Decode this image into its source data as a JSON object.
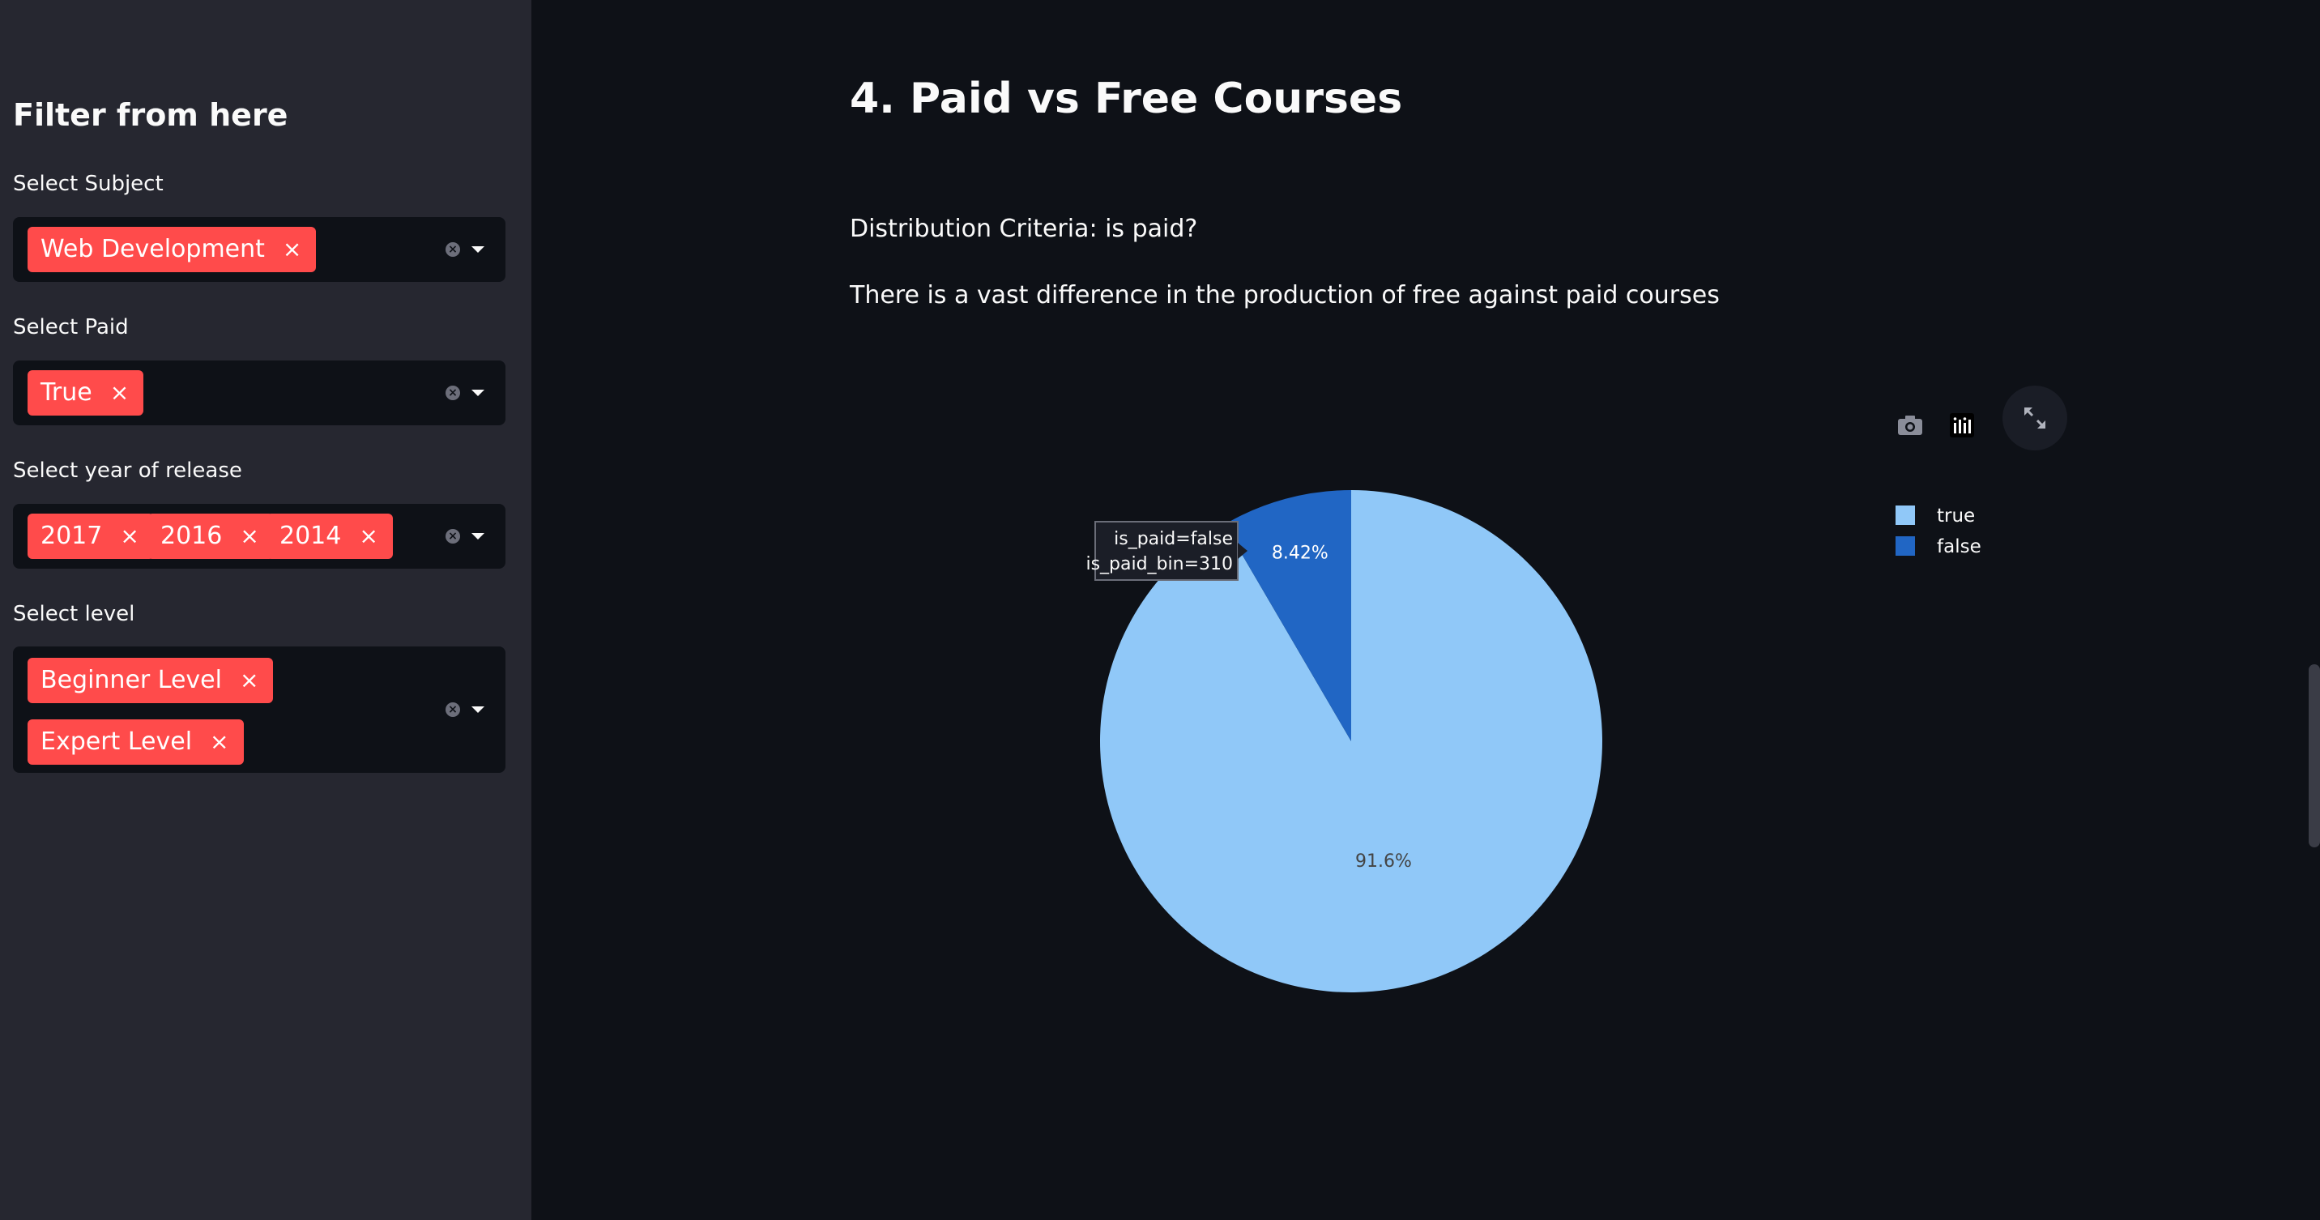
{
  "sidebar": {
    "title": "Filter from here",
    "filters": [
      {
        "label": "Select Subject",
        "tags": [
          "Web Development"
        ]
      },
      {
        "label": "Select Paid",
        "tags": [
          "True"
        ]
      },
      {
        "label": "Select year of release",
        "tags": [
          "2017",
          "2016",
          "2014"
        ]
      },
      {
        "label": "Select level",
        "tags": [
          "Beginner Level",
          "Expert Level"
        ]
      }
    ],
    "tag_remove_glyph": "×"
  },
  "main": {
    "title": "4. Paid vs Free Courses",
    "criteria": "Distribution Criteria: is paid?",
    "description": "There is a vast difference in the production of free against paid courses"
  },
  "toolbar": {
    "icons": [
      "camera-icon",
      "plotly-logo-icon",
      "fullscreen-icon"
    ]
  },
  "chart_data": {
    "type": "pie",
    "labels": [
      "true",
      "false"
    ],
    "values": [
      91.58,
      8.42
    ],
    "slice_labels": [
      "91.6%",
      "8.42%"
    ],
    "colors": [
      "#90c8f8",
      "#2166c4"
    ],
    "legend": [
      "true",
      "false"
    ],
    "legend_placement": "top-right",
    "tooltip": {
      "lines": [
        "is_paid=false",
        "is_paid_bin=310"
      ]
    }
  },
  "colors": {
    "background": "#0e1117",
    "sidebar": "#262730",
    "tag": "#ff4b4b",
    "text": "#fafafa"
  }
}
